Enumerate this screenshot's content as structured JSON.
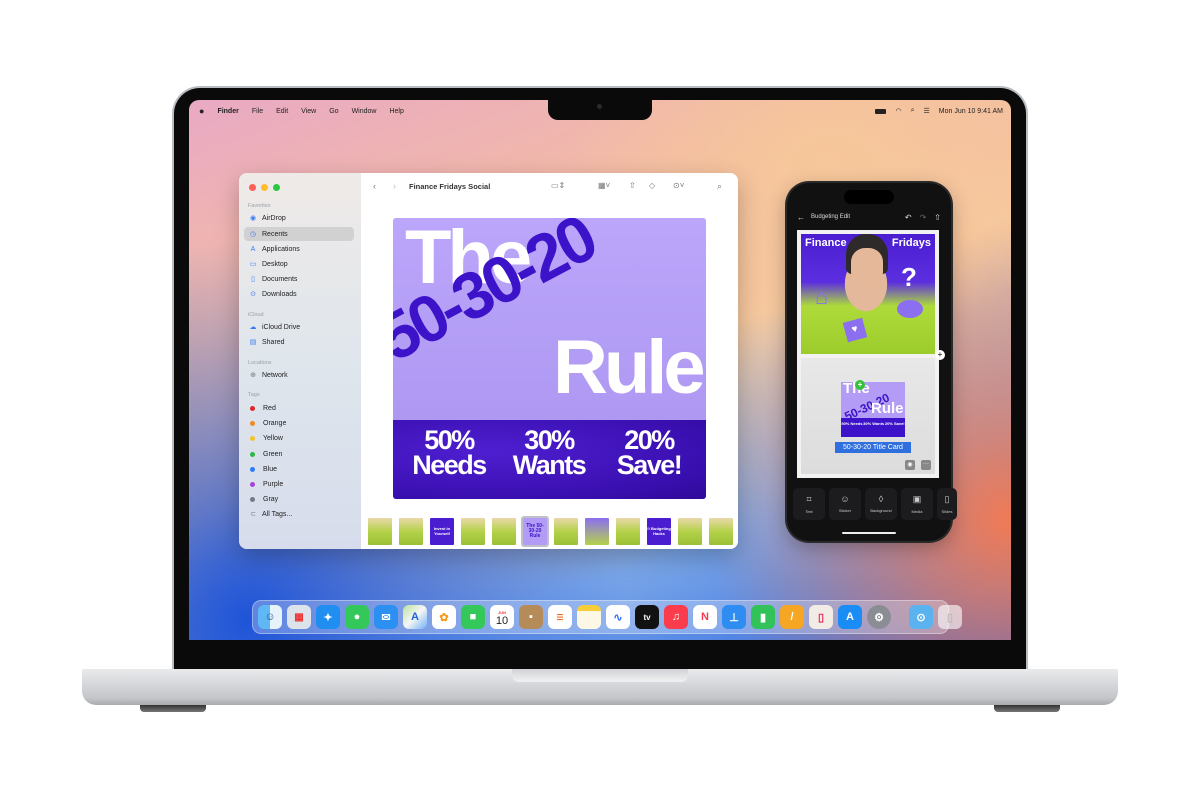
{
  "menubar": {
    "apple": "",
    "items": [
      "Finder",
      "File",
      "Edit",
      "View",
      "Go",
      "Window",
      "Help"
    ],
    "status_icons": [
      "battery-icon",
      "wifi-icon",
      "search-icon",
      "control-center-icon"
    ],
    "clock": "Mon Jun 10  9:41 AM"
  },
  "finder": {
    "title": "Finance Fridays Social",
    "sidebar": {
      "favorites_label": "Favorites",
      "favorites": [
        {
          "label": "AirDrop",
          "icon": "airdrop-icon"
        },
        {
          "label": "Recents",
          "icon": "clock-icon",
          "selected": true
        },
        {
          "label": "Applications",
          "icon": "applications-icon"
        },
        {
          "label": "Desktop",
          "icon": "desktop-icon"
        },
        {
          "label": "Documents",
          "icon": "document-icon"
        },
        {
          "label": "Downloads",
          "icon": "download-icon"
        }
      ],
      "icloud_label": "iCloud",
      "icloud": [
        {
          "label": "iCloud Drive",
          "icon": "cloud-icon"
        },
        {
          "label": "Shared",
          "icon": "shared-folder-icon"
        }
      ],
      "locations_label": "Locations",
      "locations": [
        {
          "label": "Network",
          "icon": "globe-icon"
        }
      ],
      "tags_label": "Tags",
      "tags": [
        {
          "label": "Red",
          "color": "#e0262b"
        },
        {
          "label": "Orange",
          "color": "#f08a24"
        },
        {
          "label": "Yellow",
          "color": "#f5c32c"
        },
        {
          "label": "Green",
          "color": "#2fb742"
        },
        {
          "label": "Blue",
          "color": "#2c7cf6"
        },
        {
          "label": "Purple",
          "color": "#a644d6"
        },
        {
          "label": "Gray",
          "color": "#777a84"
        }
      ],
      "all_tags": "All Tags..."
    },
    "poster": {
      "line1": "The",
      "line2": "50-30-20",
      "line3": "Rule",
      "stats": [
        {
          "pct": "50%",
          "label": "Needs"
        },
        {
          "pct": "30%",
          "label": "Wants"
        },
        {
          "pct": "20%",
          "label": "Save!"
        }
      ]
    },
    "thumbnails": [
      {
        "type": "photo"
      },
      {
        "type": "photo"
      },
      {
        "type": "text",
        "text": "Invest in Yourself"
      },
      {
        "type": "photo"
      },
      {
        "type": "photo"
      },
      {
        "type": "selected",
        "text": "The 50-30-20 Rule"
      },
      {
        "type": "photo"
      },
      {
        "type": "photo"
      },
      {
        "type": "photo"
      },
      {
        "type": "text",
        "text": "!! Budgeting Hacks"
      },
      {
        "type": "photo"
      },
      {
        "type": "photo"
      }
    ]
  },
  "phone": {
    "header_title": "Budgeting Edit",
    "photo_title_left": "Finance",
    "photo_title_right": "Fridays",
    "mini_card": {
      "line1": "The",
      "line2": "50-30-20",
      "line3": "Rule",
      "stats": [
        "50% Needs",
        "30% Wants",
        "20% Save!"
      ]
    },
    "caption": "50-30-20 Title Card",
    "tools": [
      {
        "label": "Text",
        "icon": "text-box-icon"
      },
      {
        "label": "Sticker",
        "icon": "sticker-icon"
      },
      {
        "label": "Background",
        "icon": "drop-icon"
      },
      {
        "label": "Media",
        "icon": "media-icon"
      },
      {
        "label": "Slides",
        "icon": "slides-icon"
      }
    ]
  },
  "dock": {
    "calendar_month": "JUN",
    "calendar_day": "10",
    "tv_label": "tv",
    "apps": [
      "Finder",
      "Launchpad",
      "Safari",
      "Messages",
      "Mail",
      "Maps",
      "Photos",
      "FaceTime",
      "Calendar",
      "Contacts",
      "Reminders",
      "Notes",
      "Freeform",
      "TV",
      "Music",
      "News",
      "Keynote",
      "Numbers",
      "Pages",
      "iPhone Mirroring",
      "App Store",
      "System Settings",
      "Downloads",
      "Trash"
    ]
  }
}
